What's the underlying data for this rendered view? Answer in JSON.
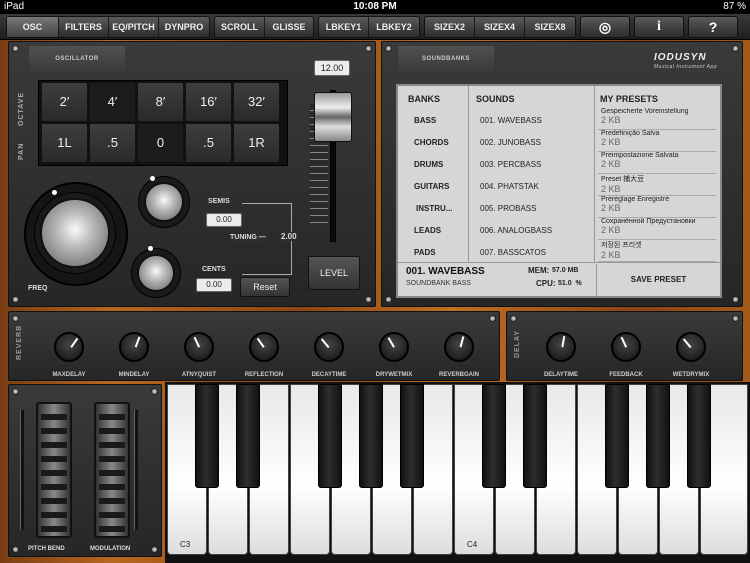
{
  "status": {
    "device": "iPad",
    "time": "10:08 PM",
    "battery": "87 %"
  },
  "toolbar": {
    "groups": [
      [
        "OSC",
        "FILTERS",
        "EQ/PITCH",
        "DYNPRO"
      ],
      [
        "SCROLL",
        "GLISSE"
      ],
      [
        "LBKEY1",
        "LBKEY2"
      ],
      [
        "SIZEX2",
        "SIZEX4",
        "SIZEX8"
      ]
    ],
    "icons": [
      "globe-icon",
      "info-icon",
      "help-icon"
    ],
    "icon_glyphs": [
      "◎",
      "i",
      "?"
    ]
  },
  "oscillator": {
    "tab": "OSCILLATOR",
    "octave_label": "OCTAVE",
    "pan_label": "PAN",
    "octave": [
      "2′",
      "4′",
      "8′",
      "16′",
      "32′"
    ],
    "pan": [
      "1L",
      ".5",
      "0",
      ".5",
      "1R"
    ],
    "freq_label": "FREQ",
    "semis_label": "SEMIS",
    "semis_value": "0.00",
    "tuning_label": "TUNING —",
    "tuning_value": "2.00",
    "cents_label": "CENTS",
    "cents_value": "0.00",
    "reset_label": "Reset",
    "level_value": "12.00",
    "level_label": "LEVEL"
  },
  "soundbanks": {
    "tab": "SOUNDBANKS",
    "logo": "IODUSYN",
    "logo_sub": "Musical Instrument App",
    "headers": {
      "banks": "BANKS",
      "sounds": "SOUNDS",
      "presets": "MY PRESETS"
    },
    "banks": [
      "BASS",
      "CHORDS",
      "DRUMS",
      "GUITARS",
      "INSTRU...",
      "LEADS",
      "PADS"
    ],
    "sounds": [
      "001. WAVEBASS",
      "002. JUNOBASS",
      "003. PERCBASS",
      "004. PHATSTAK",
      "005. PROBASS",
      "006. ANALOGBASS",
      "007. BASSCATOS"
    ],
    "presets": [
      {
        "name": "Gespeicherte Voreinstellung",
        "size": "2 KB"
      },
      {
        "name": "Predefinição Salva",
        "size": "2 KB"
      },
      {
        "name": "Preimpostazione Salvata",
        "size": "2 KB"
      },
      {
        "name": "Preset 捕大豆",
        "size": "2 KB"
      },
      {
        "name": "Préréglage Enregistré",
        "size": "2 KB"
      },
      {
        "name": "Сохранённой Предустановки",
        "size": "2 KB"
      },
      {
        "name": "저장된 프리셋",
        "size": "2 KB"
      }
    ],
    "current": "001. WAVEBASS",
    "current_bank": "SOUNDBANK BASS",
    "mem_label": "MEM:",
    "mem_value": "57.0 MB",
    "cpu_label": "CPU:",
    "cpu_value": "51.0  %",
    "save_label": "SAVE PRESET"
  },
  "reverb": {
    "label": "REVERB",
    "knobs": [
      "MAXDELAY",
      "MINDELAY",
      "ATNYQUIST",
      "REFLECTION",
      "DECAYTIME",
      "DRYWETMIX",
      "REVERBGAIN"
    ]
  },
  "delay": {
    "label": "DELAY",
    "knobs": [
      "DELAYTIME",
      "FEEDBACK",
      "WETDRYMIX"
    ]
  },
  "wheels": {
    "pitch": "PITCH BEND",
    "mod": "MODULATION"
  },
  "keyboard": {
    "c3": "C3",
    "c4": "C4"
  }
}
